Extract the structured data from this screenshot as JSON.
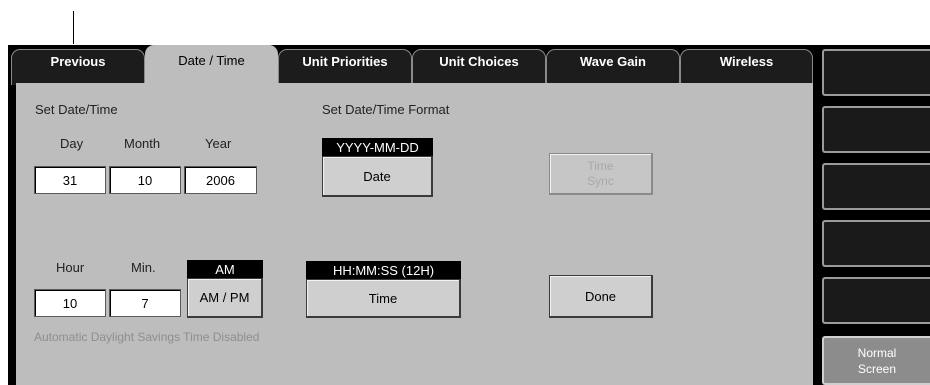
{
  "tabs": [
    "Previous",
    "Date / Time",
    "Unit Priorities",
    "Unit Choices",
    "Wave Gain",
    "Wireless"
  ],
  "date_section": {
    "title": "Set Date/Time",
    "day_label": "Day",
    "month_label": "Month",
    "year_label": "Year",
    "day_value": "31",
    "month_value": "10",
    "year_value": "2006"
  },
  "format_section": {
    "title": "Set Date/Time Format",
    "date_format": "YYYY-MM-DD",
    "date_button": "Date",
    "time_format": "HH:MM:SS (12H)",
    "time_button": "Time"
  },
  "time_section": {
    "hour_label": "Hour",
    "min_label": "Min.",
    "hour_value": "10",
    "min_value": "7",
    "ampm_current": "AM",
    "ampm_button": "AM / PM"
  },
  "time_sync": {
    "line1": "Time",
    "line2": "Sync"
  },
  "done_label": "Done",
  "dst_notice": "Automatic Daylight Savings Time Disabled",
  "rail": {
    "normal_line1": "Normal",
    "normal_line2": "Screen"
  }
}
